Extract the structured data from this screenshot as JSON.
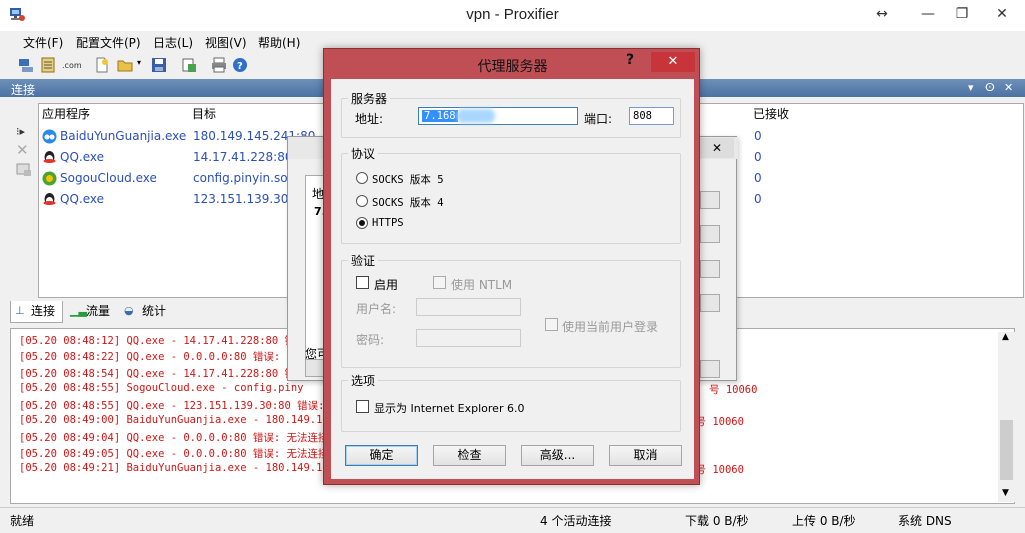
{
  "window": {
    "title": "vpn - Proxifier",
    "controls": [
      "↔",
      "—",
      "❐",
      "✕"
    ]
  },
  "menu": [
    "文件(F)",
    "配置文件(P)",
    "日志(L)",
    "视图(V)",
    "帮助(H)"
  ],
  "connections": {
    "header": "连接",
    "header_controls": [
      "▾",
      "ⵙ",
      "✕"
    ],
    "columns": [
      "应用程序",
      "目标",
      "已接收"
    ],
    "rows": [
      {
        "app": "BaiduYunGuanjia.exe",
        "target": "180.149.145.241:80",
        "received": "0",
        "icon": "baiduyun-icon"
      },
      {
        "app": "QQ.exe",
        "target": "14.17.41.228:80",
        "received": "0",
        "icon": "qq-icon"
      },
      {
        "app": "SogouCloud.exe",
        "target": "config.pinyin.sogo",
        "received": "0",
        "icon": "sogou-icon"
      },
      {
        "app": "QQ.exe",
        "target": "123.151.139.30:8",
        "received": "0",
        "icon": "qq-icon"
      }
    ]
  },
  "tabs": [
    "连接",
    "流量",
    "统计"
  ],
  "log": [
    {
      "text": "[05.20 08:48:12] QQ.exe - 14.17.41.228:80 错误",
      "tail": ""
    },
    {
      "text": "[05.20 08:48:22] QQ.exe - 0.0.0.0:80 错误: 无",
      "tail": ""
    },
    {
      "text": "[05.20 08:48:54] QQ.exe - 14.17.41.228:80 错误",
      "tail": ""
    },
    {
      "text": "[05.20 08:48:55] SogouCloud.exe - config.piny",
      "tail": "号 10060"
    },
    {
      "text": "[05.20 08:48:55] QQ.exe - 123.151.139.30:80 错误: 无",
      "tail": ""
    },
    {
      "text": "[05.20 08:49:00] BaiduYunGuanjia.exe - 180.149.145.",
      "tail": "误号 10060"
    },
    {
      "text": "[05.20 08:49:04] QQ.exe - 0.0.0.0:80 错误: 无法连接",
      "tail": ""
    },
    {
      "text": "[05.20 08:49:05] QQ.exe - 0.0.0.0:80 错误: 无法连接",
      "tail": ""
    },
    {
      "text": "[05.20 08:49:21] BaiduYunGuanjia.exe - 180.149.145.",
      "tail": "误号 10060"
    }
  ],
  "status": {
    "ready": "就绪",
    "active": "4 个活动连接",
    "download": "下载 0 B/秒",
    "upload": "上传 0 B/秒",
    "dns": "系统 DNS"
  },
  "bg_dialog": {
    "close": "✕",
    "label1": "地",
    "label2": "7.",
    "footer": "您可"
  },
  "dialog": {
    "title": "代理服务器",
    "help": "?",
    "close": "✕",
    "server": {
      "group": "服务器",
      "address_label": "地址:",
      "address_value": "7.168",
      "port_label": "端口:",
      "port_value": "808"
    },
    "protocol": {
      "group": "协议",
      "options": [
        "SOCKS 版本 5",
        "SOCKS 版本 4",
        "HTTPS"
      ],
      "selected": 2
    },
    "auth": {
      "group": "验证",
      "enable_label": "启用",
      "ntlm_label": "使用 NTLM",
      "user_label": "用户名:",
      "password_label": "密码:",
      "current_user_label": "使用当前用户登录"
    },
    "options": {
      "group": "选项",
      "ie_label": "显示为 Internet Explorer 6.0"
    },
    "buttons": {
      "ok": "确定",
      "check": "检查",
      "advanced": "高级...",
      "cancel": "取消"
    }
  }
}
